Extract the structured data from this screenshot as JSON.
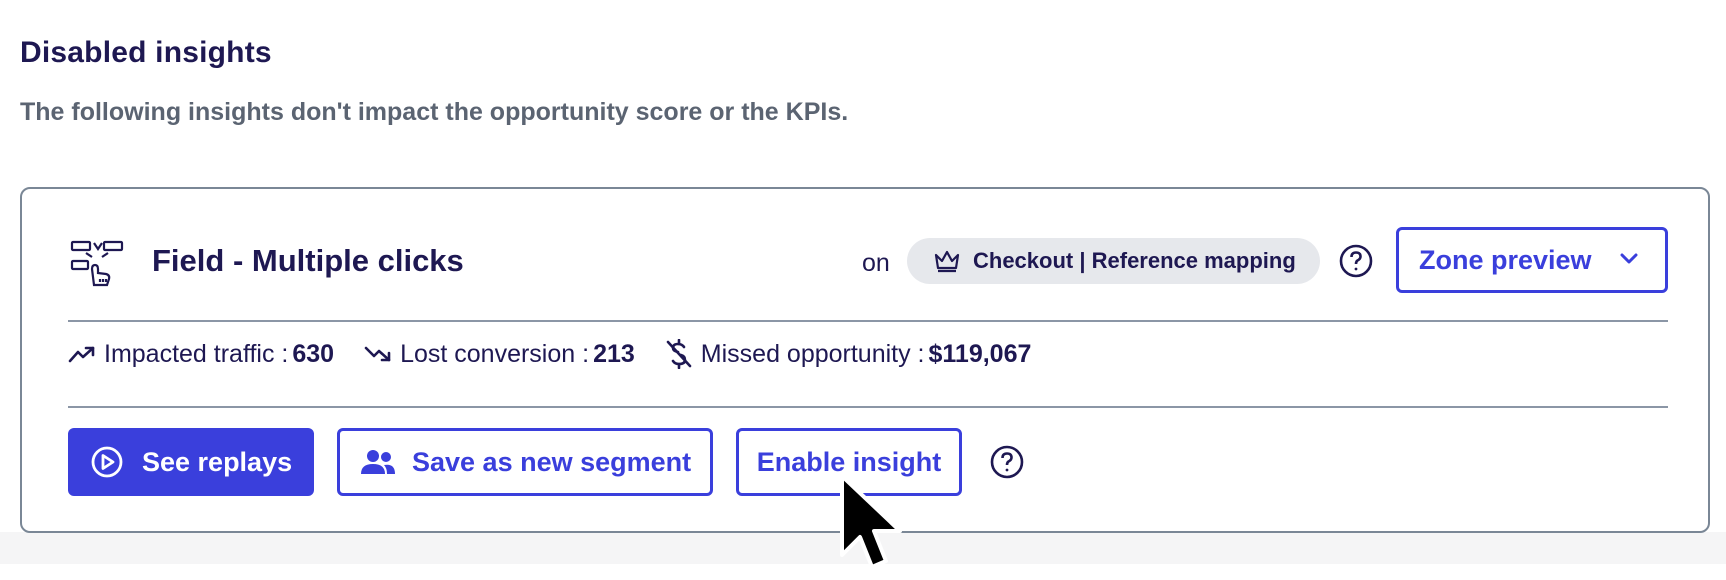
{
  "section": {
    "title": "Disabled insights",
    "description": "The following insights don't impact the opportunity score or the KPIs."
  },
  "insight": {
    "icon": "multiple-clicks-icon",
    "name": "Field - Multiple clicks",
    "on_label": "on",
    "page_chip": {
      "icon": "crown-icon",
      "label": "Checkout | Reference mapping"
    },
    "help_icon": "help-circle-icon",
    "zone_preview": {
      "label": "Zone preview",
      "icon": "chevron-down-icon"
    },
    "metrics": [
      {
        "icon": "trend-up-icon",
        "label": "Impacted traffic :",
        "value": "630"
      },
      {
        "icon": "trend-down-icon",
        "label": "Lost conversion :",
        "value": "213"
      },
      {
        "icon": "dollar-off-icon",
        "label": "Missed opportunity :",
        "value": "$119,067"
      }
    ],
    "actions": {
      "see_replays": {
        "label": "See replays",
        "icon": "play-circle-icon"
      },
      "save_segment": {
        "label": "Save as new segment",
        "icon": "users-icon"
      },
      "enable_insight": {
        "label": "Enable insight"
      }
    }
  },
  "colors": {
    "primary": "#3a3fdc",
    "title_text": "#1e1852",
    "muted_text": "#5b6472",
    "border": "#7a8796",
    "chip_bg": "#e6e8ec"
  }
}
